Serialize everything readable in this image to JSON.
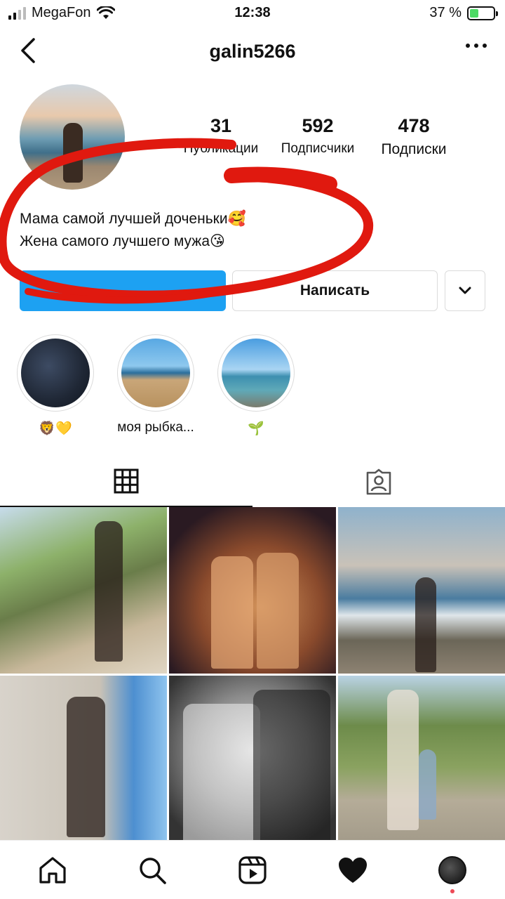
{
  "status_bar": {
    "carrier": "MegaFon",
    "time": "12:38",
    "battery_percent": "37 %",
    "battery_level": 0.37
  },
  "header": {
    "username": "galin5266",
    "icons": {
      "back": "chevron-left-icon",
      "more": "more-horizontal-icon"
    }
  },
  "profile": {
    "stats": [
      {
        "value": "31",
        "label": "Публикации"
      },
      {
        "value": "592",
        "label": "Подписчики"
      },
      {
        "value": "478",
        "label": "Подписки"
      }
    ],
    "bio_lines": [
      "Мама самой лучшей доченьки🥰",
      "Жена самого лучшего мужа😘"
    ]
  },
  "actions": {
    "message_label": "Написать",
    "colors": {
      "follow": "#1da1f2",
      "annotation": "#e0190f"
    }
  },
  "highlights": [
    {
      "label": "🦁💛"
    },
    {
      "label": "моя рыбка..."
    },
    {
      "label": "🌱"
    }
  ],
  "tabs": [
    {
      "icon": "grid-icon",
      "active": true
    },
    {
      "icon": "tagged-person-icon",
      "active": false
    }
  ],
  "posts_count_visible": 6,
  "bottom_nav": {
    "items": [
      "home-icon",
      "search-icon",
      "reels-icon",
      "heart-icon",
      "profile-avatar"
    ],
    "notification_color": "#ed4956"
  }
}
